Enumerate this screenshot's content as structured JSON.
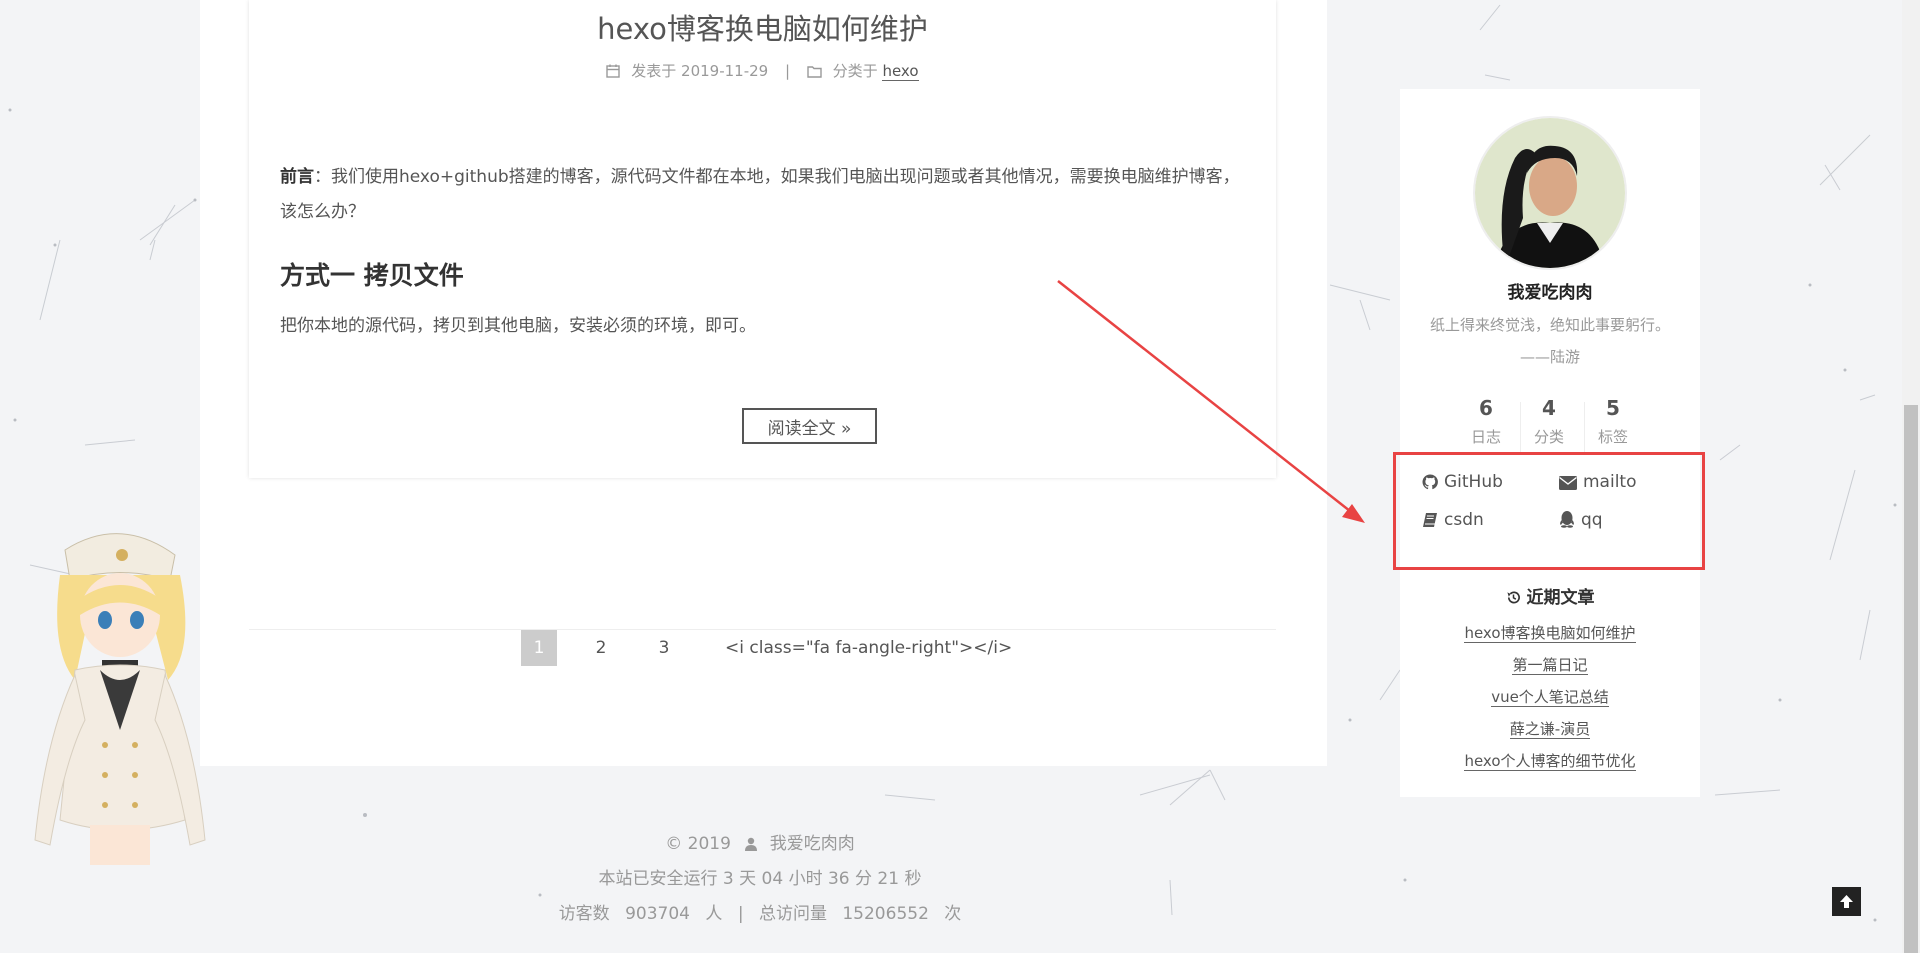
{
  "post": {
    "title": "hexo博客换电脑如何维护",
    "meta_posted_label": "发表于",
    "meta_date": "2019-11-29",
    "meta_divider": "|",
    "meta_category_label": "分类于",
    "meta_category": "hexo",
    "intro_label": "前言",
    "intro_text": "：我们使用hexo+github搭建的博客，源代码文件都在本地，如果我们电脑出现问题或者其他情况，需要换电脑维护博客，该怎么办？",
    "heading": "方式一 拷贝文件",
    "paragraph": "把你本地的源代码，拷贝到其他电脑，安装必须的环境，即可。",
    "read_more": "阅读全文 »"
  },
  "pagination": {
    "pages": [
      "1",
      "2",
      "3"
    ],
    "current": "1",
    "next_raw": "<i class=\"fa fa-angle-right\"></i>"
  },
  "sidebar": {
    "author_name": "我爱吃肉肉",
    "motto_line1": "纸上得来终觉浅，绝知此事要躬行。",
    "motto_line2": "——陆游",
    "stats": [
      {
        "count": "6",
        "label": "日志"
      },
      {
        "count": "4",
        "label": "分类"
      },
      {
        "count": "5",
        "label": "标签"
      }
    ],
    "links": [
      {
        "label": "GitHub",
        "icon": "github-icon"
      },
      {
        "label": "mailto",
        "icon": "envelope-icon"
      },
      {
        "label": "csdn",
        "icon": "book-icon"
      },
      {
        "label": "qq",
        "icon": "qq-icon"
      }
    ],
    "recent_title": "近期文章",
    "recent_icon": "history-icon",
    "recent_posts": [
      "hexo博客换电脑如何维护",
      "第一篇日记",
      "vue个人笔记总结",
      "薛之谦-演员",
      "hexo个人博客的细节优化"
    ]
  },
  "footer": {
    "copyright": "© 2019",
    "author": "我爱吃肉肉",
    "runtime": "本站已安全运行 3 天 04 小时 36 分 21 秒",
    "visitors_label": "访客数",
    "visitors_count": "903704",
    "visitors_unit": "人",
    "divider": "|",
    "views_label": "总访问量",
    "views_count": "15206552",
    "views_unit": "次"
  },
  "colors": {
    "highlight": "#e84343",
    "background": "#f3f4f6"
  }
}
